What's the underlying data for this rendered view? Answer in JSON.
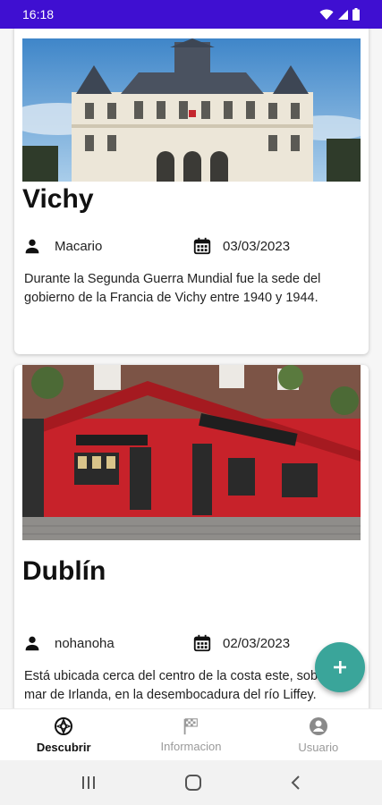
{
  "status_bar": {
    "time": "16:18"
  },
  "cards": [
    {
      "title": "Vichy",
      "user": "Macario",
      "date": "03/03/2023",
      "description": "Durante la Segunda Guerra Mundial fue la sede del gobierno de la Francia de Vichy entre 1940 y 1944."
    },
    {
      "title": "Dublín",
      "user": "nohanoha",
      "date": "02/03/2023",
      "description": "Está ubicada cerca del centro de la costa este, sobre el mar de Irlanda, en la desembocadura del río Liffey."
    }
  ],
  "bottom_nav": {
    "items": [
      {
        "label": "Descubrir",
        "icon": "compass-icon",
        "active": true
      },
      {
        "label": "Informacion",
        "icon": "flag-icon",
        "active": false
      },
      {
        "label": "Usuario",
        "icon": "account-icon",
        "active": false
      }
    ]
  },
  "colors": {
    "status_bar": "#3f0fd1",
    "fab": "#3aa59a"
  }
}
